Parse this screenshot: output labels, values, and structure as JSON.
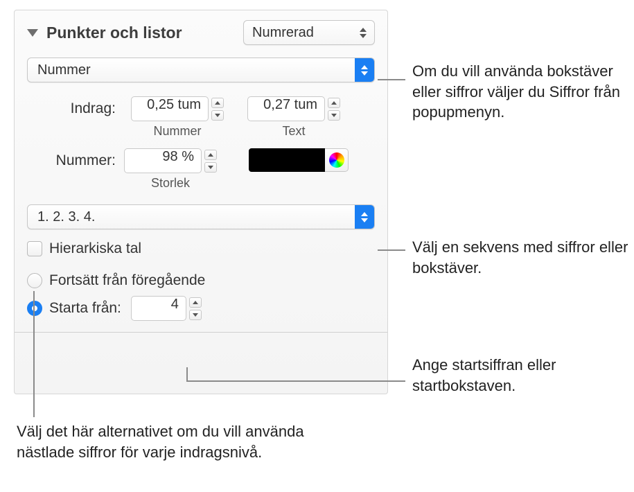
{
  "header": {
    "title": "Punkter och listor",
    "style_value": "Numrerad"
  },
  "type_popup": {
    "value": "Nummer"
  },
  "indent": {
    "label": "Indrag:",
    "number_value": "0,25 tum",
    "number_sublabel": "Nummer",
    "text_value": "0,27 tum",
    "text_sublabel": "Text"
  },
  "number_size": {
    "label": "Nummer:",
    "value": "98 %",
    "sublabel": "Storlek"
  },
  "sequence_popup": {
    "value": "1. 2. 3. 4."
  },
  "options": {
    "hierarchical": "Hierarkiska tal",
    "continue": "Fortsätt från föregående",
    "start_from": "Starta från:",
    "start_value": "4"
  },
  "callouts": {
    "c1": "Om du vill använda bokstäver eller siffror väljer du Siffror från popupmenyn.",
    "c2": "Välj en sekvens med siffror eller bokstäver.",
    "c3": "Ange startsiffran eller startbokstaven.",
    "c4": "Välj det här alternativet om du vill använda nästlade siffror för varje indragsnivå."
  }
}
